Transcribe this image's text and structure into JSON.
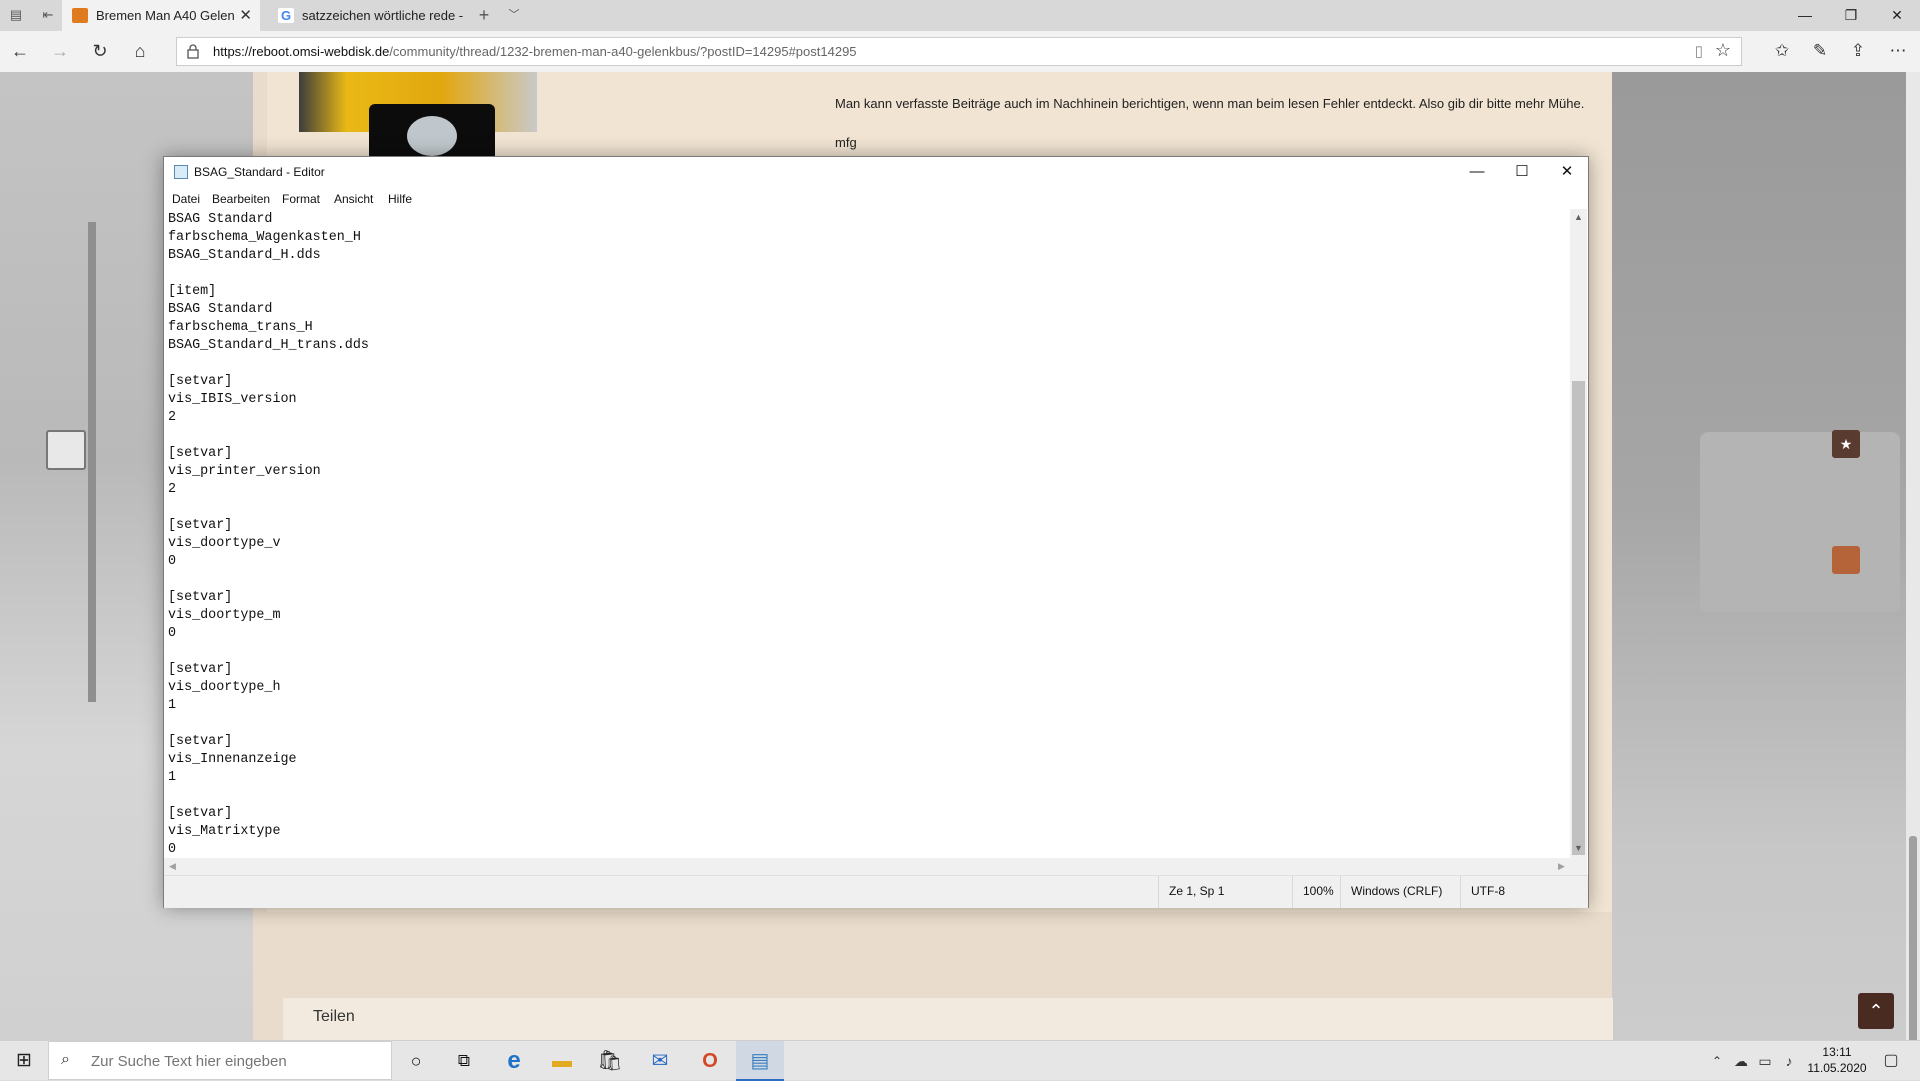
{
  "browser": {
    "tabs": [
      {
        "label": "Bremen Man A40 Gelen",
        "favicon_color": "#e07a1f",
        "active": true
      },
      {
        "label": "satzzeichen wörtliche rede -",
        "favicon_color": "#4285f4",
        "active": false
      }
    ],
    "new_tab_icon": "plus-icon",
    "url_host": "https://reboot.omsi-webdisk.de",
    "url_path": "/community/thread/1232-bremen-man-a40-gelenkbus/?postID=14295#post14295"
  },
  "post": {
    "text_line1": "Man kann verfasste Beiträge auch im Nachhinein berichtigen, wenn man beim lesen Fehler entdeckt. Also gib dir bitte mehr Mühe.",
    "text_line2": "mfg",
    "share_label": "Teilen"
  },
  "notepad": {
    "title": "BSAG_Standard - Editor",
    "menu": [
      "Datei",
      "Bearbeiten",
      "Format",
      "Ansicht",
      "Hilfe"
    ],
    "content": "BSAG Standard\nfarbschema_Wagenkasten_H\nBSAG_Standard_H.dds\n\n[item]\nBSAG Standard\nfarbschema_trans_H\nBSAG_Standard_H_trans.dds\n\n[setvar]\nvis_IBIS_version\n2\n\n[setvar]\nvis_printer_version\n2\n\n[setvar]\nvis_doortype_v\n0\n\n[setvar]\nvis_doortype_m\n0\n\n[setvar]\nvis_doortype_h\n1\n\n[setvar]\nvis_Innenanzeige\n1\n\n[setvar]\nvis_Matrixtype\n0",
    "status": {
      "position": "Ze 1, Sp 1",
      "zoom": "100%",
      "line_endings": "Windows (CRLF)",
      "encoding": "UTF-8"
    }
  },
  "taskbar": {
    "search_placeholder": "Zur Suche Text hier eingeben",
    "time": "13:11",
    "date": "11.05.2020"
  },
  "colors": {
    "accent": "#2b6cc4",
    "forum_bg": "#f1e4d3",
    "up_button": "#4a2b22"
  }
}
